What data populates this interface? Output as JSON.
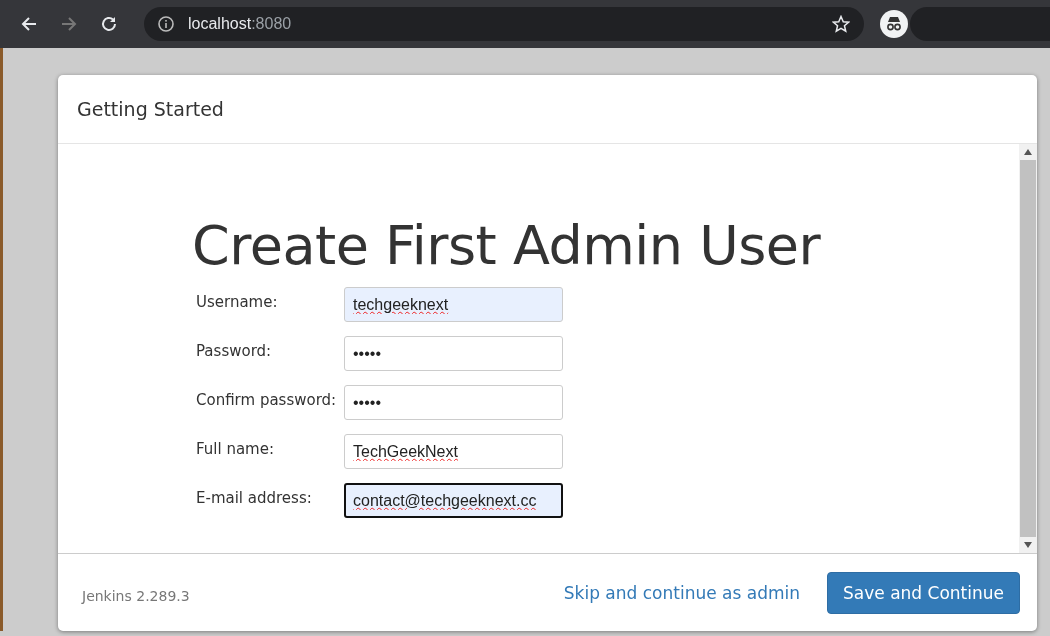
{
  "browser": {
    "url_host": "localhost",
    "url_port": ":8080"
  },
  "dialog": {
    "title": "Getting Started"
  },
  "heading": "Create First Admin User",
  "fields": [
    {
      "label": "Username:",
      "value": "techgeeknext",
      "autofilled": true,
      "focused": false,
      "misspelled": true
    },
    {
      "label": "Password:",
      "value": "•••••",
      "autofilled": false,
      "focused": false,
      "misspelled": false
    },
    {
      "label": "Confirm password:",
      "value": "•••••",
      "autofilled": false,
      "focused": false,
      "misspelled": false
    },
    {
      "label": "Full name:",
      "value": "TechGeekNext",
      "autofilled": false,
      "focused": false,
      "misspelled": true
    },
    {
      "label": "E-mail address:",
      "value": "contact@techgeeknext.cc",
      "autofilled": true,
      "focused": true,
      "misspelled": true
    }
  ],
  "footer": {
    "version": "Jenkins 2.289.3",
    "skip_link": "Skip and continue as admin",
    "save_button": "Save and Continue"
  }
}
